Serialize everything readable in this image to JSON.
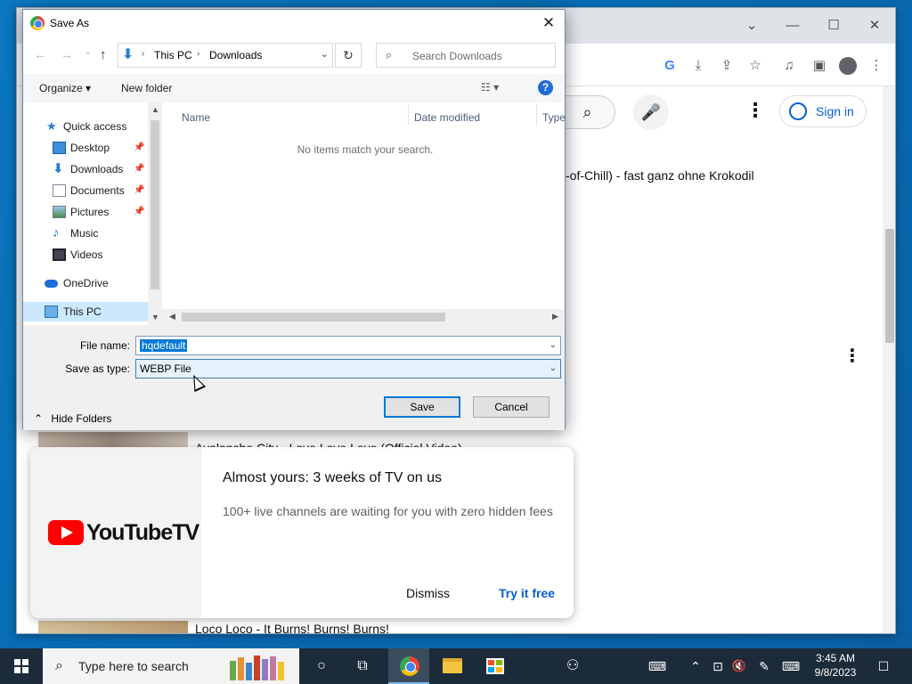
{
  "dialog": {
    "title": "Save As",
    "close_glyph": "✕",
    "nav": {
      "back": "←",
      "forward": "→",
      "recent": "⌄",
      "up": "↑"
    },
    "address": {
      "parts": [
        "This PC",
        "Downloads"
      ],
      "sep": "›",
      "drop": "⌄"
    },
    "refresh_glyph": "↻",
    "search_placeholder": "Search Downloads",
    "commands": {
      "organize": "Organize ▾",
      "new_folder": "New folder",
      "view": "☷ ▾",
      "help": "?"
    },
    "sidebar": {
      "items": [
        {
          "label": "Quick access",
          "icon": "star-icon"
        },
        {
          "label": "Desktop",
          "icon": "desktop-icon",
          "pinned": true
        },
        {
          "label": "Downloads",
          "icon": "downloads-icon",
          "pinned": true
        },
        {
          "label": "Documents",
          "icon": "documents-icon",
          "pinned": true
        },
        {
          "label": "Pictures",
          "icon": "pictures-icon",
          "pinned": true
        },
        {
          "label": "Music",
          "icon": "music-icon"
        },
        {
          "label": "Videos",
          "icon": "videos-icon"
        },
        {
          "label": "OneDrive",
          "icon": "onedrive-icon"
        },
        {
          "label": "This PC",
          "icon": "this-pc-icon",
          "selected": true
        }
      ],
      "pin_glyph": "📌"
    },
    "columns": [
      "Name",
      "Date modified",
      "Type"
    ],
    "empty_message": "No items match your search.",
    "file_name_label": "File name:",
    "file_name_value": "hqdefault",
    "save_as_type_label": "Save as type:",
    "save_as_type_value": "WEBP File",
    "hide_folders": "Hide Folders",
    "save_label": "Save",
    "cancel_label": "Cancel"
  },
  "browser": {
    "controls": {
      "chevron": "⌄",
      "minimize": "—",
      "maximize": "☐",
      "close": "✕"
    },
    "toolbar_icons": {
      "google": "G",
      "install": "⤓",
      "share": "⇪",
      "bookmark": "☆",
      "media": "♫",
      "sidepanel": "▣",
      "profile": "●",
      "menu": "⋮"
    }
  },
  "youtube": {
    "search_glyph": "⌕",
    "mic_glyph": "🎤",
    "menu_glyph": "⋮",
    "sign_in": "Sign in",
    "video_title_1": "-of-Chill) - fast ganz ohne Krokodil",
    "video_title_2": "Avalanche City - Love Love Love (Official Video)",
    "video_title_3": "Loco Loco - It Burns! Burns! Burns!",
    "promo": {
      "logo_text": "YouTubeTV",
      "title": "Almost yours: 3 weeks of TV on us",
      "subtitle": "100+ live channels are waiting for you with zero hidden fees",
      "dismiss": "Dismiss",
      "try": "Try it free"
    }
  },
  "taskbar": {
    "search_placeholder": "Type here to search",
    "search_glyph": "⌕",
    "cortana_glyph": "○",
    "task_view_glyph": "⧉",
    "people_glyph": "⚇",
    "tray": {
      "keyboard_glyph": "⌨",
      "up_glyph": "⌃",
      "network_glyph": "⊡",
      "volume_glyph": "🔇",
      "pen_glyph": "✎",
      "ime_glyph": "⌨",
      "notification_glyph": "☐"
    },
    "time": "3:45 AM",
    "date": "9/8/2023"
  },
  "colors": {
    "selection": "#0078d7",
    "accent_blue": "#065fd4",
    "youtube_red": "#ff0000",
    "taskbar": "#1c2b3a"
  }
}
